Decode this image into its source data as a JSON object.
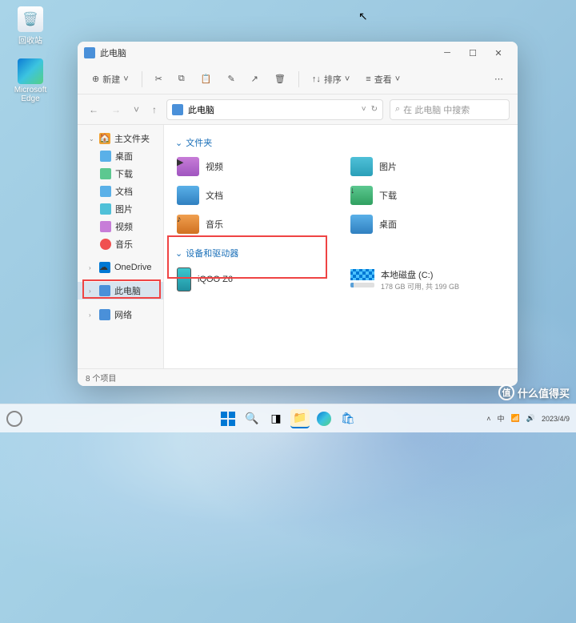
{
  "desktop": {
    "recycle": "回收站",
    "edge": "Microsoft Edge"
  },
  "window": {
    "title": "此电脑",
    "toolbar": {
      "new": "新建",
      "sort": "排序",
      "view": "查看"
    },
    "address": "此电脑",
    "search_placeholder": "在 此电脑 中搜索",
    "sidebar": {
      "home": "主文件夹",
      "desktop": "桌面",
      "downloads": "下载",
      "documents": "文档",
      "pictures": "图片",
      "videos": "视频",
      "music": "音乐",
      "onedrive": "OneDrive",
      "thispc": "此电脑",
      "network": "网络"
    },
    "sections": {
      "folders": "文件夹",
      "devices": "设备和驱动器"
    },
    "folders": {
      "videos": "视频",
      "pictures": "图片",
      "documents": "文档",
      "downloads": "下载",
      "music": "音乐",
      "desktop": "桌面"
    },
    "devices": {
      "phone": "iQOO Z6",
      "drive_name": "本地磁盘 (C:)",
      "drive_info": "178 GB 可用, 共 199 GB"
    },
    "status": "8 个项目"
  },
  "taskbar": {
    "date": "2023/4/9"
  },
  "watermark": "什么值得买"
}
